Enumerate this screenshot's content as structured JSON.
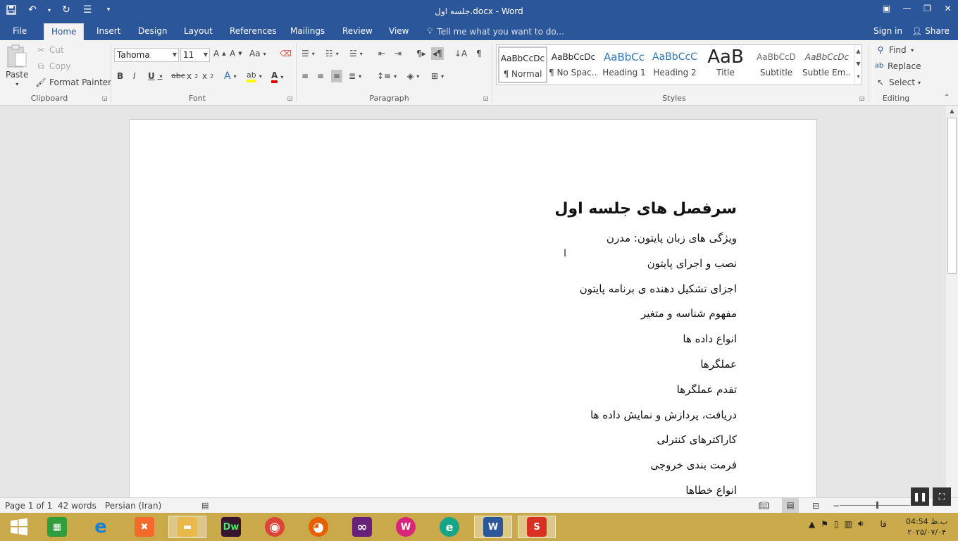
{
  "window": {
    "title": "جلسه اول.docx - Word"
  },
  "tabs": [
    {
      "label": "File"
    },
    {
      "label": "Home"
    },
    {
      "label": "Insert"
    },
    {
      "label": "Design"
    },
    {
      "label": "Layout"
    },
    {
      "label": "References"
    },
    {
      "label": "Mailings"
    },
    {
      "label": "Review"
    },
    {
      "label": "View"
    }
  ],
  "tellme": {
    "placeholder": "Tell me what you want to do..."
  },
  "account": {
    "signin": "Sign in",
    "share": "Share"
  },
  "clipboard": {
    "paste": "Paste",
    "cut": "Cut",
    "copy": "Copy",
    "format_painter": "Format Painter",
    "group": "Clipboard"
  },
  "font": {
    "name": "Tahoma",
    "size": "11",
    "group": "Font"
  },
  "paragraph": {
    "group": "Paragraph"
  },
  "styles": {
    "group": "Styles",
    "items": [
      {
        "preview": "AaBbCcDc",
        "label": "¶ Normal"
      },
      {
        "preview": "AaBbCcDc",
        "label": "¶ No Spac..."
      },
      {
        "preview": "AaBbCc",
        "label": "Heading 1"
      },
      {
        "preview": "AaBbCcC",
        "label": "Heading 2"
      },
      {
        "preview": "AaB",
        "label": "Title"
      },
      {
        "preview": "AaBbCcD",
        "label": "Subtitle"
      },
      {
        "preview": "AaBbCcDc",
        "label": "Subtle Em..."
      }
    ]
  },
  "editing": {
    "find": "Find",
    "replace": "Replace",
    "select": "Select",
    "group": "Editing"
  },
  "document": {
    "title": "سرفصل های جلسه اول",
    "lines": [
      "ویژگی های زبان پایتون: مدرن",
      "نصب و اجرای پایتون",
      "اجزای تشکیل دهنده ی برنامه پایتون",
      "مفهوم شناسه و متغیر",
      "انواع داده ها",
      "عملگرها",
      "تقدم عملگرها",
      "دریافت، پردازش و نمایش داده ها",
      "کاراکترهای کنترلی",
      "فرمت بندی خروجی",
      "انواع خطاها"
    ]
  },
  "status": {
    "page": "Page 1 of 1",
    "words": "42 words",
    "language": "Persian (Iran)"
  },
  "taskbar": {
    "apps": [
      {
        "name": "start",
        "glyph": "⊞",
        "color": "#ffffff"
      },
      {
        "name": "store",
        "glyph": "▦",
        "color": "#2e9e3e"
      },
      {
        "name": "ie",
        "glyph": "e",
        "color": "#1a7fd6"
      },
      {
        "name": "xampp",
        "glyph": "✖",
        "color": "#f26b2b"
      },
      {
        "name": "explorer",
        "glyph": "▬",
        "color": "#e8b84a"
      },
      {
        "name": "dreamweaver",
        "glyph": "Dw",
        "color": "#35162e"
      },
      {
        "name": "chrome",
        "glyph": "◉",
        "color": "#db4437"
      },
      {
        "name": "firefox",
        "glyph": "◕",
        "color": "#e66000"
      },
      {
        "name": "visual-studio",
        "glyph": "∞",
        "color": "#68217a"
      },
      {
        "name": "wamp",
        "glyph": "W",
        "color": "#d9267a"
      },
      {
        "name": "e-app",
        "glyph": "e",
        "color": "#17a589"
      },
      {
        "name": "word",
        "glyph": "W",
        "color": "#2b579a"
      },
      {
        "name": "recorder",
        "glyph": "S",
        "color": "#d93025"
      }
    ],
    "lang": "فا",
    "clock_time": "04:54 ب.ظ",
    "clock_date": "۲۰۲۵/۰۷/۰۴"
  }
}
